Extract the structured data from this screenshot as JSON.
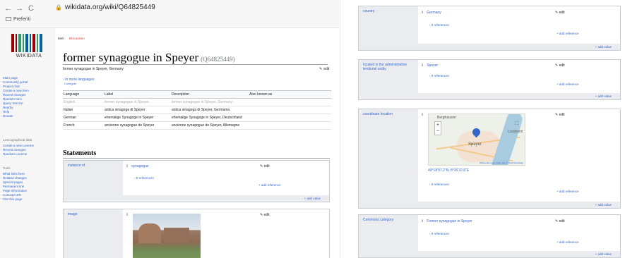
{
  "browser": {
    "back": "←",
    "forward": "→",
    "reload": "C",
    "url": "wikidata.org/wiki/Q64825449",
    "bookmark": "Preferiti"
  },
  "brand": {
    "logo_text": "WIKIDATA",
    "bar_colors": [
      "#990000",
      "#339966",
      "#006699"
    ]
  },
  "sidebar": {
    "groups": [
      {
        "heading": "",
        "items": [
          "Main page",
          "Community portal",
          "Project chat",
          "Create a new Item",
          "Recent changes",
          "Random Item",
          "Query Service",
          "Nearby",
          "Help",
          "Donate"
        ]
      },
      {
        "heading": "Lexicographical data",
        "items": [
          "Create a new Lexeme",
          "Recent changes",
          "Random Lexeme"
        ]
      },
      {
        "heading": "Tools",
        "items": [
          "What links here",
          "Related changes",
          "Special pages",
          "Permanent link",
          "Page information",
          "Concept URI",
          "Cite this page"
        ]
      }
    ]
  },
  "tabs": {
    "item": "Item",
    "discussion": "Discussion"
  },
  "page": {
    "title": "former synagogue in Speyer",
    "qid": "(Q64825449)",
    "description": "former synagogue in Speyer, Germany",
    "edit": "edit",
    "more_languages": "In more languages",
    "configure": "Configure"
  },
  "languages": {
    "headers": [
      "Language",
      "Label",
      "Description",
      "Also known as"
    ],
    "rows": [
      {
        "language": "English",
        "label": "former synagogue in Speyer",
        "description": "former synagogue in Speyer, Germany",
        "aliases": "",
        "muted": true
      },
      {
        "language": "Italian",
        "label": "antica sinagoga di Speyer",
        "description": "antica sinagoga di Speyer, Germania",
        "aliases": "",
        "muted": false
      },
      {
        "language": "German",
        "label": "ehemalige Synagoge in Speyer",
        "description": "ehemalige Synagoge in Speyer, Deutschland",
        "aliases": "",
        "muted": false
      },
      {
        "language": "French",
        "label": "ancienne synagogue de Speyer",
        "description": "ancienne synagogue de Speyer, Allemagne",
        "aliases": "",
        "muted": false
      }
    ]
  },
  "statements": {
    "heading": "Statements",
    "rank_icon": "⇕",
    "refs": "› 0 references",
    "add_reference": "+ add reference",
    "add_value": "+ add value",
    "edit": "edit",
    "instance_of": {
      "property": "instance of",
      "value": "synagogue"
    },
    "image": {
      "property": "image"
    },
    "country": {
      "property": "country",
      "value": "Germany"
    },
    "admin_entity": {
      "property": "located in the administrative territorial entity",
      "value": "Speyer"
    },
    "coordinate": {
      "property": "coordinate location",
      "value": "49°18'57.2\"N, 8°26'32.8\"E",
      "map_city": "Speyer",
      "map_place_top": "Berghausen",
      "map_place_right": "Lussheim",
      "map_attribution": "Wikimedia maps | Map data © OpenStreetMap"
    },
    "commons": {
      "property": "Commons category",
      "value": "Former synagogue in Speyer"
    }
  }
}
